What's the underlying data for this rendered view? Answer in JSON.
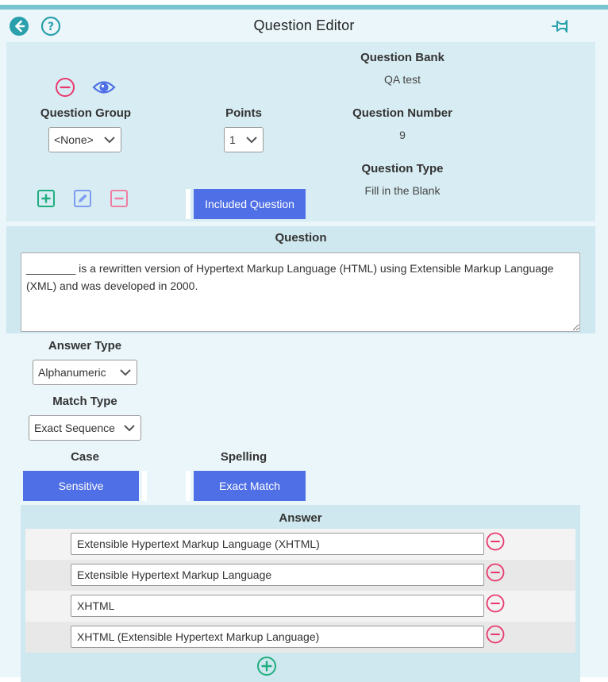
{
  "header": {
    "title": "Question Editor"
  },
  "question_bank": {
    "label": "Question Bank",
    "value": "QA test"
  },
  "question_number": {
    "label": "Question Number",
    "value": "9"
  },
  "question_type": {
    "label": "Question Type",
    "value": "Fill in the Blank"
  },
  "question_group": {
    "label": "Question Group",
    "selected": "<None>"
  },
  "points": {
    "label": "Points",
    "selected": "1"
  },
  "included_button": "Included Question",
  "question": {
    "label": "Question",
    "text": "________ is a rewritten version of Hypertext Markup Language (HTML) using Extensible Markup Language (XML) and was developed in 2000."
  },
  "answer_type": {
    "label": "Answer Type",
    "selected": "Alphanumeric"
  },
  "match_type": {
    "label": "Match Type",
    "selected": "Exact Sequence"
  },
  "case": {
    "label": "Case",
    "button": "Sensitive"
  },
  "spelling": {
    "label": "Spelling",
    "button": "Exact Match"
  },
  "answers": {
    "label": "Answer",
    "items": [
      "Extensible Hypertext Markup Language (XHTML)",
      "Extensible Hypertext Markup Language",
      "XHTML",
      "XHTML (Extensible Hypertext Markup Language)"
    ]
  },
  "colors": {
    "accent_blue": "#4f6fe6",
    "teal": "#2aa0ad",
    "remove_pink": "#e8386d",
    "add_green": "#1fae7e"
  }
}
